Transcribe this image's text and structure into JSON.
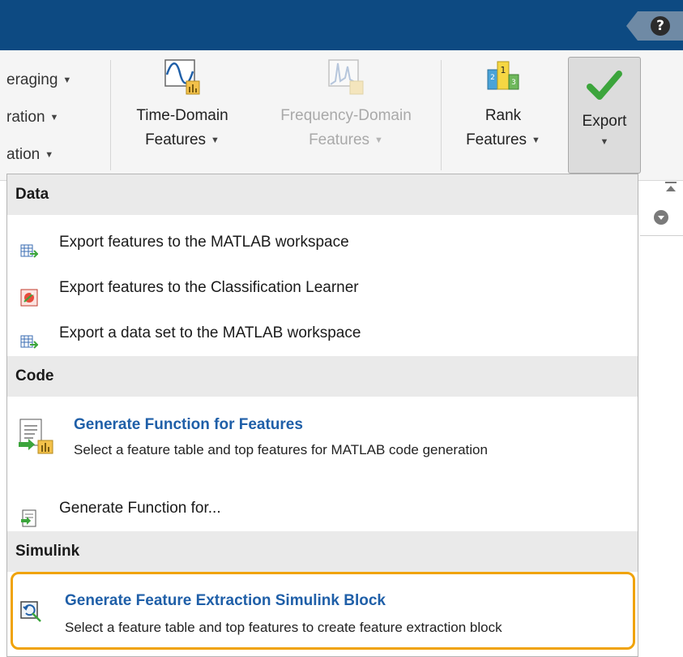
{
  "ribbon": {
    "left_items": [
      "eraging",
      "ration",
      "ation"
    ],
    "time_domain": {
      "line1": "Time-Domain",
      "line2": "Features"
    },
    "freq_domain": {
      "line1": "Frequency-Domain",
      "line2": "Features"
    },
    "rank": {
      "line1": "Rank",
      "line2": "Features"
    },
    "export": {
      "label": "Export"
    }
  },
  "help": {
    "symbol": "?"
  },
  "menu": {
    "data_header": "Data",
    "data_items": [
      "Export features to the MATLAB workspace",
      "Export features to the Classification Learner",
      "Export a data set to the MATLAB workspace"
    ],
    "code_header": "Code",
    "gen_func_features": {
      "title": "Generate Function for Features",
      "desc": "Select a feature table and top features for MATLAB code generation"
    },
    "gen_func_for": "Generate Function for...",
    "simulink_header": "Simulink",
    "gen_simulink": {
      "title": "Generate Feature Extraction Simulink Block",
      "desc": "Select a feature table and top features to create feature extraction block"
    }
  },
  "colors": {
    "title_bar": "#0d4a82",
    "link_blue": "#1f5fa8",
    "highlight": "#f0a30a",
    "check_green": "#3ca53c"
  }
}
